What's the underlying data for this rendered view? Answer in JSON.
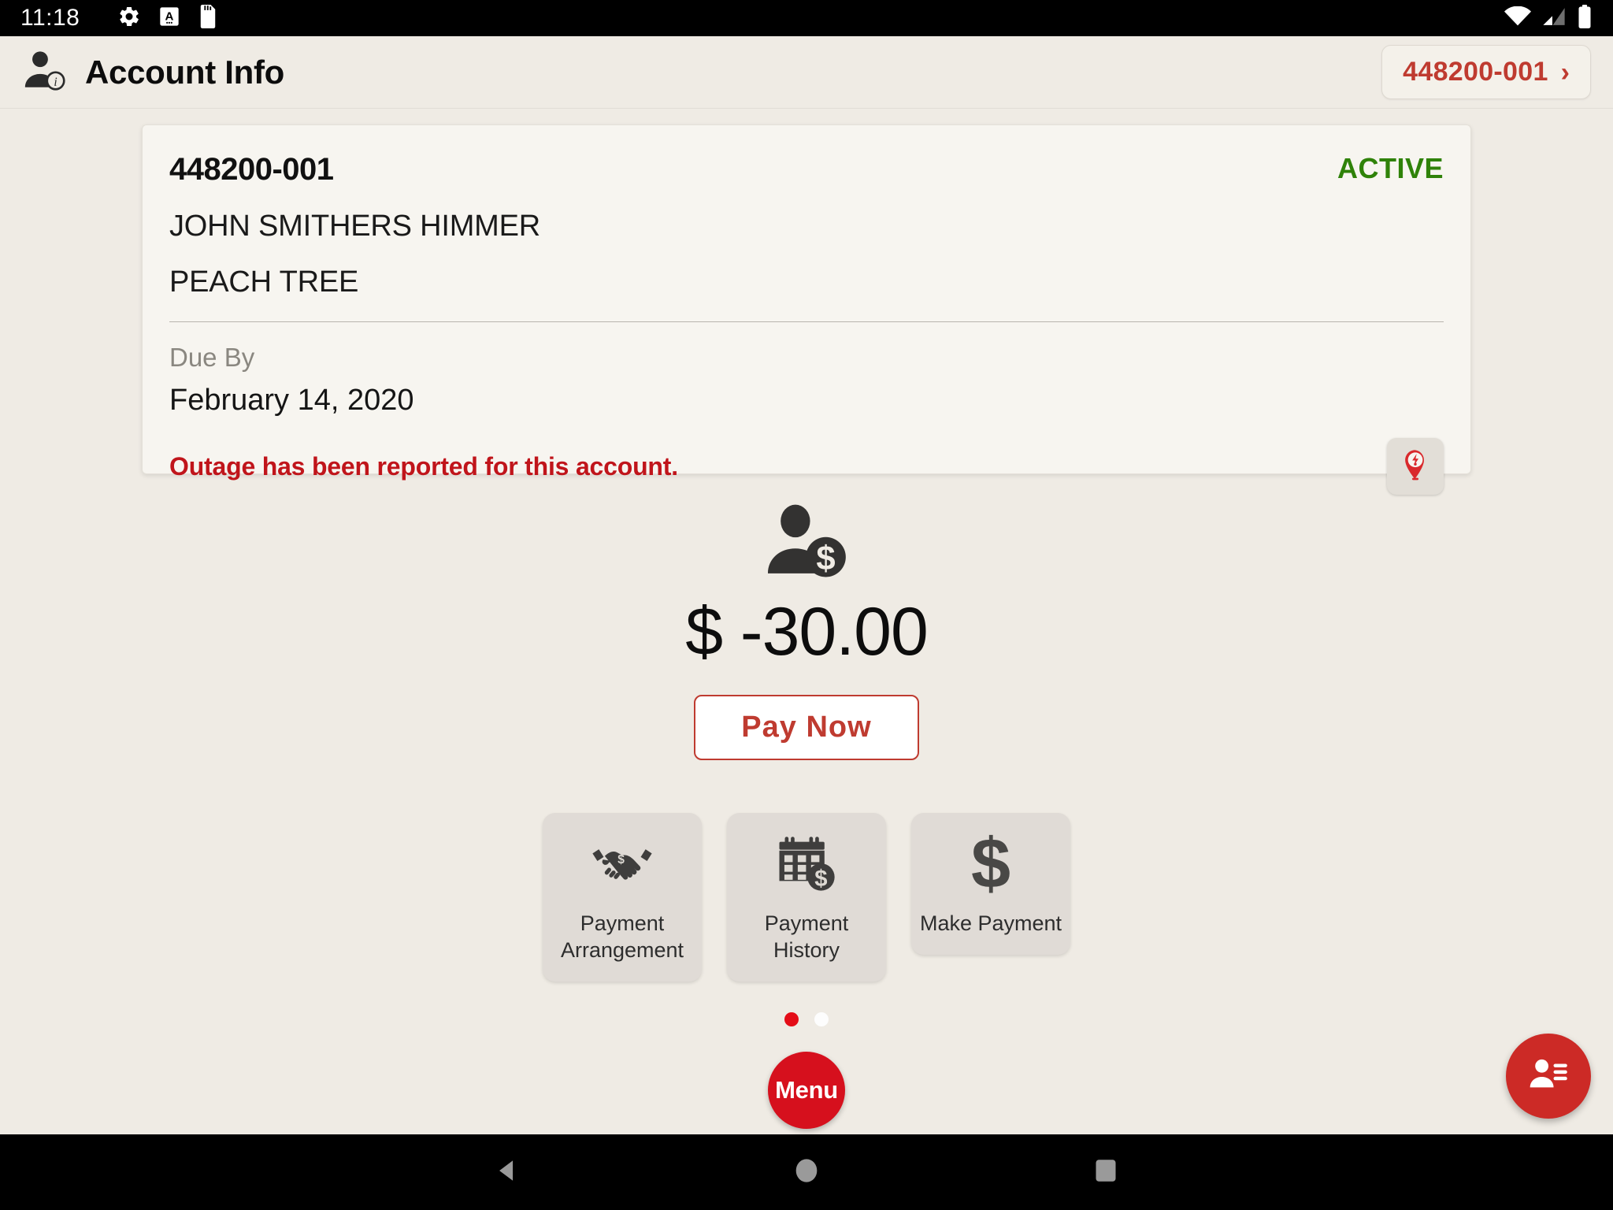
{
  "status_bar": {
    "time": "11:18",
    "left_icons": [
      "settings-gear-icon",
      "a-app-icon",
      "sd-card-icon"
    ],
    "right_icons": [
      "wifi-icon",
      "cellular-signal-icon",
      "battery-icon"
    ]
  },
  "header": {
    "icon": "account-info-icon",
    "title": "Account Info",
    "account_chip": {
      "label": "448200-001",
      "chevron": "›"
    }
  },
  "account_card": {
    "account_number": "448200-001",
    "status": "ACTIVE",
    "status_color": "#2f8209",
    "customer_name": "JOHN SMITHERS HIMMER",
    "address": "PEACH TREE",
    "due_by_label": "Due By",
    "due_by_date": "February 14, 2020",
    "outage_message": "Outage has been reported for this account.",
    "outage_color": "#c0151b",
    "outage_button_icon": "outage-pin-icon"
  },
  "balance": {
    "icon": "person-dollar-icon",
    "amount": "$ -30.00",
    "pay_now_label": "Pay Now",
    "accent_color": "#bf3b30"
  },
  "tiles": [
    {
      "icon": "handshake-dollar-icon",
      "label_line1": "Payment",
      "label_line2": "Arrangement"
    },
    {
      "icon": "calendar-dollar-icon",
      "label_line1": "Payment",
      "label_line2": "History"
    },
    {
      "icon": "dollar-sign-icon",
      "label_line1": "Make Payment",
      "label_line2": ""
    }
  ],
  "pager": {
    "total": 2,
    "active_index": 0,
    "active_color": "#e40d17",
    "inactive_color": "#fdfdfd"
  },
  "menu_fab": {
    "label": "Menu",
    "color": "#d6101d"
  },
  "contact_fab": {
    "icon": "contact-list-icon",
    "color": "#cc2a26"
  },
  "nav_bar": {
    "back": "back-triangle-icon",
    "home": "home-circle-icon",
    "recents": "recents-square-icon"
  }
}
